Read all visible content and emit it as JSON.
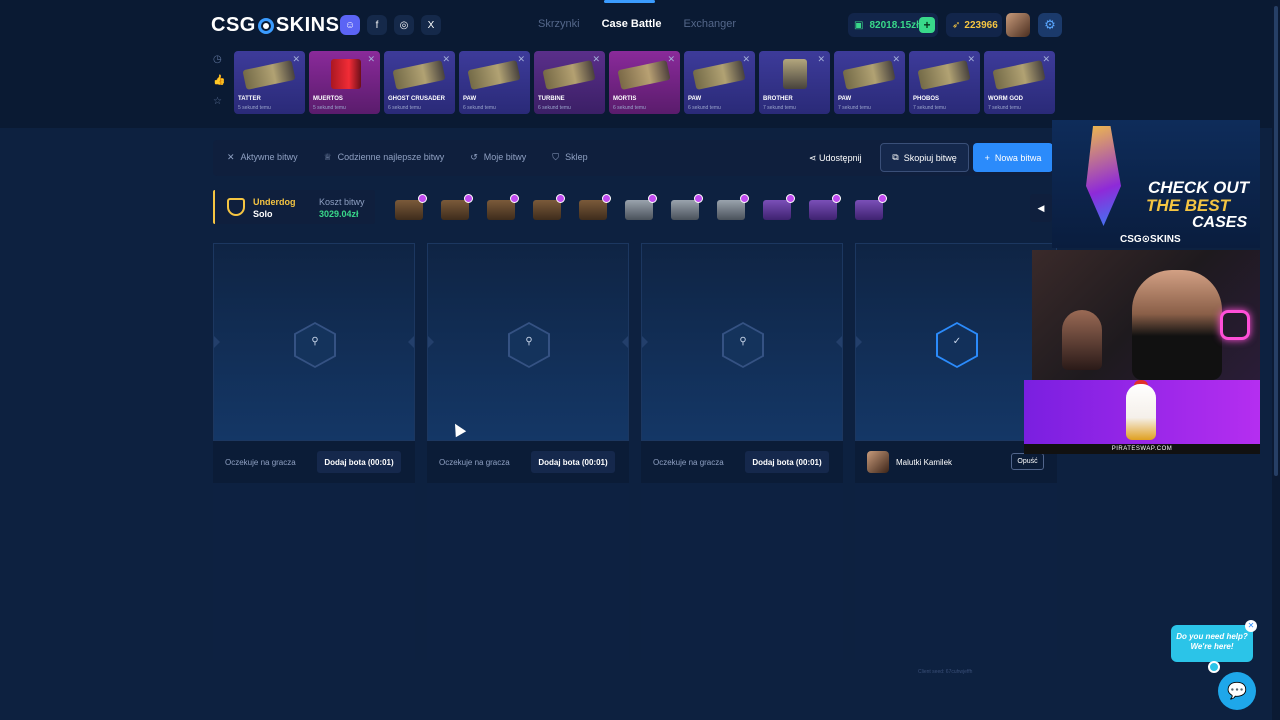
{
  "brand": {
    "logo_left": "CSG",
    "logo_right": "SKINS"
  },
  "socials": [
    {
      "name": "discord-icon",
      "glyph": "☺"
    },
    {
      "name": "facebook-icon",
      "glyph": "f"
    },
    {
      "name": "instagram-icon",
      "glyph": "◎"
    },
    {
      "name": "x-icon",
      "glyph": "X"
    }
  ],
  "nav": {
    "items": [
      "Skrzynki",
      "Case Battle",
      "Exchanger"
    ],
    "active": "Case Battle"
  },
  "wallet": {
    "balance": "82018.15zł",
    "coins": "223966"
  },
  "drops": [
    {
      "name": "TATTER",
      "time": "5 sekund temu",
      "color": "blue"
    },
    {
      "name": "MUERTOS",
      "time": "5 sekund temu",
      "color": "pink"
    },
    {
      "name": "GHOST CRUSADER",
      "time": "6 sekund temu",
      "color": "blue"
    },
    {
      "name": "PAW",
      "time": "6 sekund temu",
      "color": "blue"
    },
    {
      "name": "TURBINE",
      "time": "6 sekund temu",
      "color": "purple"
    },
    {
      "name": "MORTIS",
      "time": "6 sekund temu",
      "color": "pink"
    },
    {
      "name": "PAW",
      "time": "6 sekund temu",
      "color": "blue"
    },
    {
      "name": "BROTHER",
      "time": "7 sekund temu",
      "color": "blue"
    },
    {
      "name": "PAW",
      "time": "7 sekund temu",
      "color": "blue"
    },
    {
      "name": "PHOBOS",
      "time": "7 sekund temu",
      "color": "blue"
    },
    {
      "name": "WORM GOD",
      "time": "7 sekund temu",
      "color": "blue"
    }
  ],
  "toolbar": {
    "active": "Aktywne bitwy",
    "best": "Codzienne najlepsze bitwy",
    "mine": "Moje bitwy",
    "shop": "Sklep",
    "share": "Udostępnij",
    "copy": "Skopiuj bitwę",
    "new": "Nowa bitwa"
  },
  "battle": {
    "mode": "Underdog",
    "type": "Solo",
    "cost_label": "Koszt bitwy",
    "cost": "3029.04zł",
    "cases": [
      "brown",
      "brown",
      "brown",
      "brown",
      "brown",
      "silver",
      "silver",
      "silver",
      "purple",
      "purple",
      "purple"
    ]
  },
  "players": [
    {
      "status": "Oczekuje na gracza",
      "action": "Dodaj bota (00:01)"
    },
    {
      "status": "Oczekuje na gracza",
      "action": "Dodaj bota (00:01)"
    },
    {
      "status": "Oczekuje na gracza",
      "action": "Dodaj bota (00:01)"
    },
    {
      "name": "Malutki Kamilek",
      "action": "Opuść"
    }
  ],
  "seed": "Client seed: 67cuhwjeffh",
  "promo": {
    "line1": "CHECK OUT",
    "line2": "THE BEST",
    "line3": "CASES",
    "brand": "CSG⊙SKINS"
  },
  "ad": {
    "site": "PIRATESWAP.COM"
  },
  "help": {
    "line1": "Do you need help?",
    "line2": "We're here!"
  }
}
